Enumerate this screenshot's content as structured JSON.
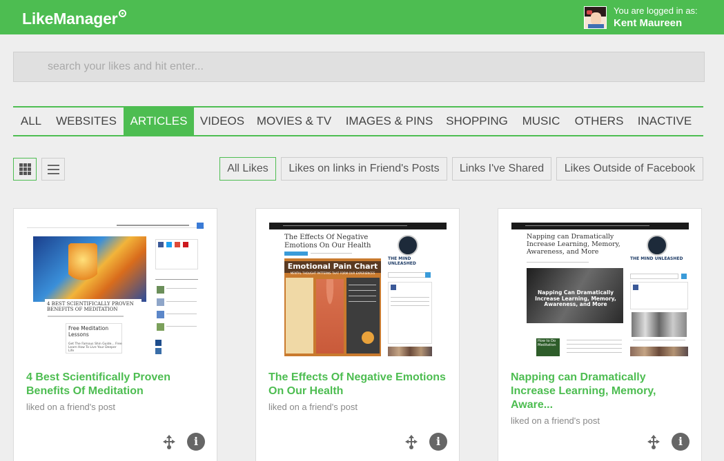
{
  "header": {
    "logo": "LikeManager",
    "logged_label": "You are logged in as:",
    "user_name": "Kent Maureen"
  },
  "search": {
    "placeholder": "search your likes and hit enter..."
  },
  "tabs": [
    {
      "label": "ALL",
      "active": false
    },
    {
      "label": "WEBSITES",
      "active": false
    },
    {
      "label": "ARTICLES",
      "active": true
    },
    {
      "label": "VIDEOS",
      "active": false
    },
    {
      "label": "MOVIES & TV",
      "active": false
    },
    {
      "label": "IMAGES & PINS",
      "active": false
    },
    {
      "label": "SHOPPING",
      "active": false
    },
    {
      "label": "MUSIC",
      "active": false
    },
    {
      "label": "OTHERS",
      "active": false
    },
    {
      "label": "INACTIVE",
      "active": false
    }
  ],
  "view_modes": [
    {
      "name": "grid",
      "active": true
    },
    {
      "name": "list",
      "active": false
    }
  ],
  "filters": [
    {
      "label": "All Likes",
      "active": true
    },
    {
      "label": "Likes on links in Friend's Posts",
      "active": false
    },
    {
      "label": "Links I've Shared",
      "active": false
    },
    {
      "label": "Likes Outside of Facebook",
      "active": false
    }
  ],
  "cards": [
    {
      "title": "4 Best Scientifically Proven Benefits Of Meditation",
      "subtitle": "liked on a friend's post",
      "thumb_heading": "4 BEST SCIENTIFICALLY PROVEN BENEFITS OF MEDITATION",
      "thumb_box_title": "Free Meditation Lessons",
      "thumb_box_text": "Get The Famous Shin Guide... Free Learn How To Live Your Deeper Life",
      "share_icon": "share-icon",
      "info_icon": "info-icon"
    },
    {
      "title": "The Effects Of Negative Emotions On Our Health",
      "subtitle": "liked on a friend's post",
      "thumb_heading": "The Effects Of Negative Emotions On Our Health",
      "thumb_chart_title": "Emotional Pain Chart",
      "thumb_chart_sub": "MENTAL THOUGHT PATTERNS THAT FORM OUR EXPERIENCES",
      "thumb_logo": "THE MIND UNLEASHED",
      "share_icon": "share-icon",
      "info_icon": "info-icon"
    },
    {
      "title": "Napping can Dramatically Increase Learning, Memory, Aware...",
      "subtitle": "liked on a friend's post",
      "thumb_heading": "Napping can Dramatically Increase Learning, Memory, Awareness, and More",
      "thumb_image_text": "Napping Can Dramatically Increase Learning, Memory, Awareness, and More",
      "thumb_logo": "THE MIND UNLEASHED",
      "thumb_book": "How to Do Meditation",
      "share_icon": "share-icon",
      "info_icon": "info-icon"
    }
  ],
  "colors": {
    "brand_green": "#4dbd51",
    "background": "#eeeeee",
    "card_title": "#4dbd51"
  }
}
